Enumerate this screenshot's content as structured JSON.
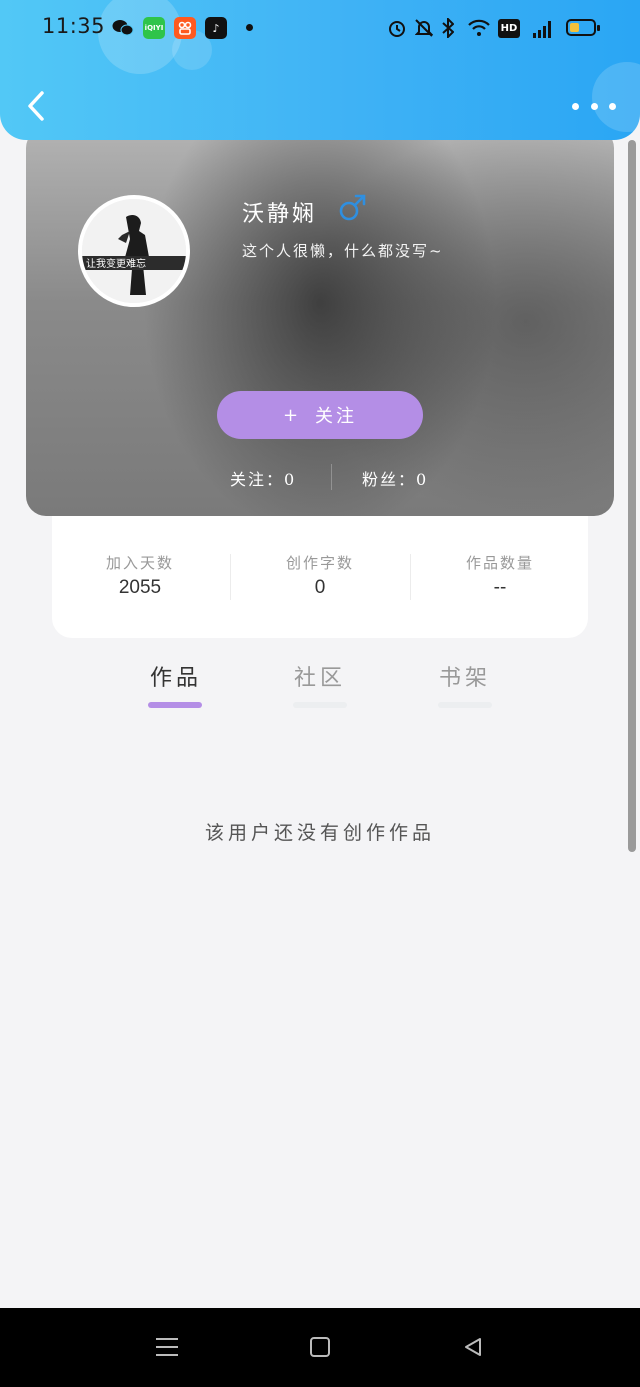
{
  "status_bar": {
    "time": "11:35",
    "apps": [
      "wechat-icon",
      "iqiyi-icon",
      "kuaishou-icon",
      "tiktok-icon"
    ],
    "iqiyi_label": "iQIYI",
    "hd_label": "HD",
    "signal_label": "4G",
    "battery_color": "#f3c23b"
  },
  "header": {
    "back_icon": "chevron-left-icon",
    "more_icon": "more-dots-icon",
    "color": "#3fb2f5"
  },
  "profile": {
    "name": "沃静娴",
    "gender_icon": "male-icon",
    "bio": "这个人很懒，什么都没写~",
    "follow_button": "关注",
    "follow_plus": "+",
    "following_label": "关注：0",
    "fans_label": "粉丝：0",
    "button_color": "#b48ee6",
    "avatar_text": "让我变更难忘"
  },
  "stats": [
    {
      "label": "加入天数",
      "value": "2055"
    },
    {
      "label": "创作字数",
      "value": "0"
    },
    {
      "label": "作品数量",
      "value": "--"
    }
  ],
  "tabs": [
    {
      "label": "作品",
      "active": true
    },
    {
      "label": "社区",
      "active": false
    },
    {
      "label": "书架",
      "active": false
    }
  ],
  "empty_message": "该用户还没有创作作品",
  "system_nav": [
    "menu-icon",
    "home-icon",
    "back-triangle-icon"
  ]
}
